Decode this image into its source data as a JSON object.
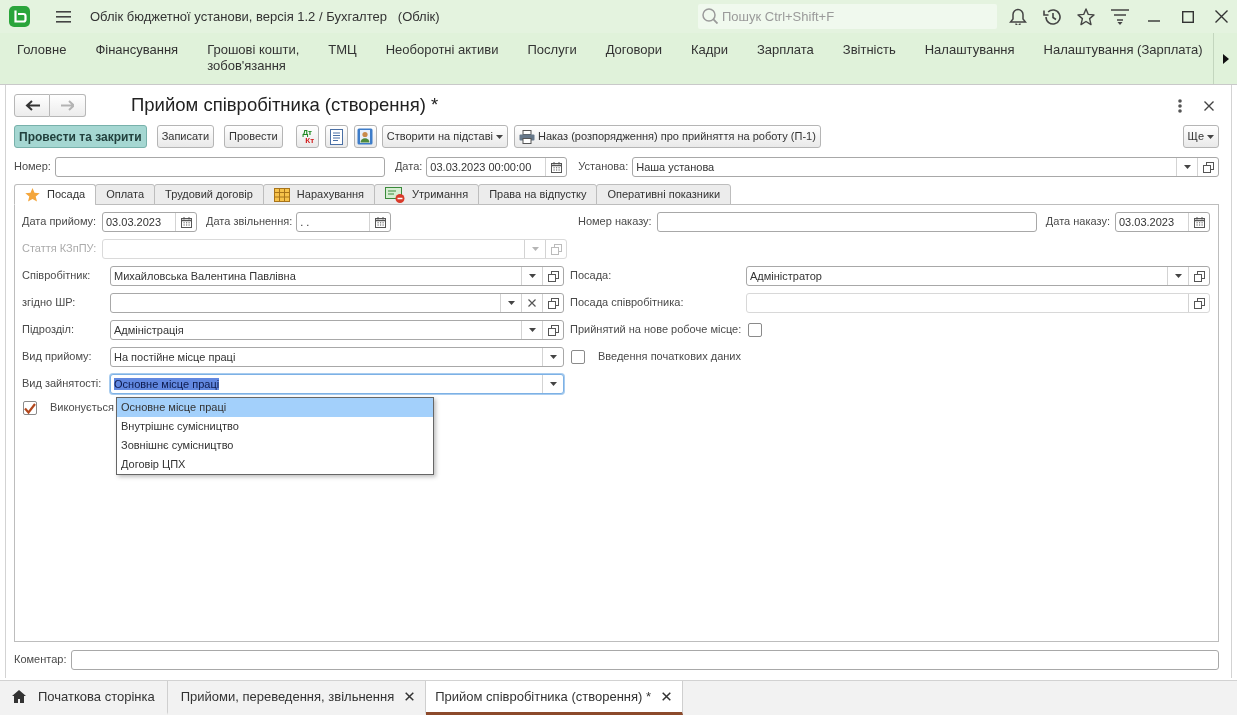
{
  "window": {
    "title": "Облік бюджетної установи, версія 1.2 / Бухгалтер   (Облік)",
    "search": {
      "placeholder": "Пошук Ctrl+Shift+F"
    }
  },
  "sections": [
    {
      "label": "Головне"
    },
    {
      "label": "Фінансування"
    },
    {
      "label": "Грошові кошти,\nзобов'язання"
    },
    {
      "label": "ТМЦ"
    },
    {
      "label": "Необоротні активи"
    },
    {
      "label": "Послуги"
    },
    {
      "label": "Договори"
    },
    {
      "label": "Кадри"
    },
    {
      "label": "Зарплата"
    },
    {
      "label": "Звітність"
    },
    {
      "label": "Налаштування"
    },
    {
      "label": "Налаштування (Зарплата)"
    }
  ],
  "document": {
    "title": "Прийом співробітника (створення) *",
    "back": {
      "disabled": false
    },
    "forward": {
      "disabled": true
    },
    "toolbar": [
      {
        "kind": "primary",
        "label": "Провести та закрити"
      },
      {
        "kind": "button",
        "label": "Записати"
      },
      {
        "kind": "button",
        "label": "Провести"
      },
      {
        "kind": "postings",
        "debit": "Дт",
        "credit": "Кт"
      },
      {
        "kind": "report"
      },
      {
        "kind": "contacts"
      },
      {
        "kind": "menu",
        "label": "Створити на підставі"
      },
      {
        "kind": "print",
        "label": "Наказ (розпорядження) про прийняття на роботу (П-1)"
      }
    ],
    "more": {
      "label": "Ще"
    },
    "number": {
      "label": "Номер:"
    },
    "date": {
      "label": "Дата:",
      "value": "03.03.2023 00:00:00"
    },
    "organization": {
      "label": "Установа:",
      "value": "Наша установа"
    },
    "tabs": [
      {
        "kind": "favorite",
        "label": "Посада",
        "selected": true
      },
      {
        "kind": "plain",
        "label": "Оплата",
        "selected": false
      },
      {
        "kind": "plain",
        "label": "Трудовий договір",
        "selected": false
      },
      {
        "kind": "accruals",
        "label": "Нарахування",
        "selected": false
      },
      {
        "kind": "deductions",
        "label": "Утримання",
        "selected": false
      },
      {
        "kind": "plain",
        "label": "Права на відпустку",
        "selected": false
      },
      {
        "kind": "plain",
        "label": "Оперативні показники",
        "selected": false
      }
    ],
    "position_tab": {
      "hire_date": {
        "label": "Дата прийому:",
        "value": "03.03.2023"
      },
      "dismissal_date": {
        "label": "Дата звільнення:",
        "value": ". ."
      },
      "order_number": {
        "label": "Номер наказу:"
      },
      "order_date": {
        "label": "Дата наказу:",
        "value": "03.03.2023"
      },
      "labor_article": {
        "label": "Стаття КЗпПУ:",
        "disabled": true
      },
      "left": [
        {
          "label": "Співробітник:",
          "value": "Михайловська Валентина Павлівна",
          "buttons": [
            {
              "kind": "dropdown"
            },
            {
              "kind": "open"
            }
          ],
          "focused": false
        },
        {
          "label": "згідно ШР:",
          "buttons": [
            {
              "kind": "dropdown"
            },
            {
              "kind": "clear"
            },
            {
              "kind": "open"
            }
          ],
          "focused": false
        },
        {
          "label": "Підрозділ:",
          "value": "Адміністрація",
          "buttons": [
            {
              "kind": "dropdown"
            },
            {
              "kind": "open"
            }
          ],
          "focused": false
        },
        {
          "label": "Вид прийому:",
          "value": "На постійне місце праці",
          "buttons": [
            {
              "kind": "dropdown"
            }
          ],
          "focused": false
        },
        {
          "label": "Вид зайнятості:",
          "value": "Основне місце праці",
          "buttons": [
            {
              "kind": "dropdown"
            }
          ],
          "focused": true
        }
      ],
      "right": [
        {
          "kind": "field",
          "label": "Посада:",
          "value": "Адміністратор",
          "buttons": [
            {
              "kind": "dropdown"
            },
            {
              "kind": "open"
            }
          ],
          "readonly": false
        },
        {
          "kind": "field",
          "label": "Посада співробітника:",
          "buttons": [
            {
              "kind": "open"
            }
          ],
          "readonly": true
        },
        {
          "kind": "flag",
          "label": "Прийнятий на нове робоче місце:",
          "checked": false
        },
        {
          "kind": "checkbox",
          "label": "Введення початкових даних",
          "checked": false
        }
      ],
      "performed": {
        "label": "Виконується",
        "checked": true
      },
      "dropdown_list": [
        {
          "label": "Основне місце праці",
          "selected": true
        },
        {
          "label": "Внутрішнє сумісництво",
          "selected": false
        },
        {
          "label": "Зовнішнє сумісництво",
          "selected": false
        },
        {
          "label": "Договір ЦПХ",
          "selected": false
        }
      ]
    },
    "comment": {
      "label": "Коментар:"
    }
  },
  "open_tabs": [
    {
      "kind": "home",
      "label": "Початкова сторінка",
      "selected": false
    },
    {
      "kind": "page",
      "label": "Прийоми, переведення, звільнення",
      "selected": false
    },
    {
      "kind": "page",
      "label": "Прийом співробітника (створення) *",
      "selected": true
    }
  ]
}
